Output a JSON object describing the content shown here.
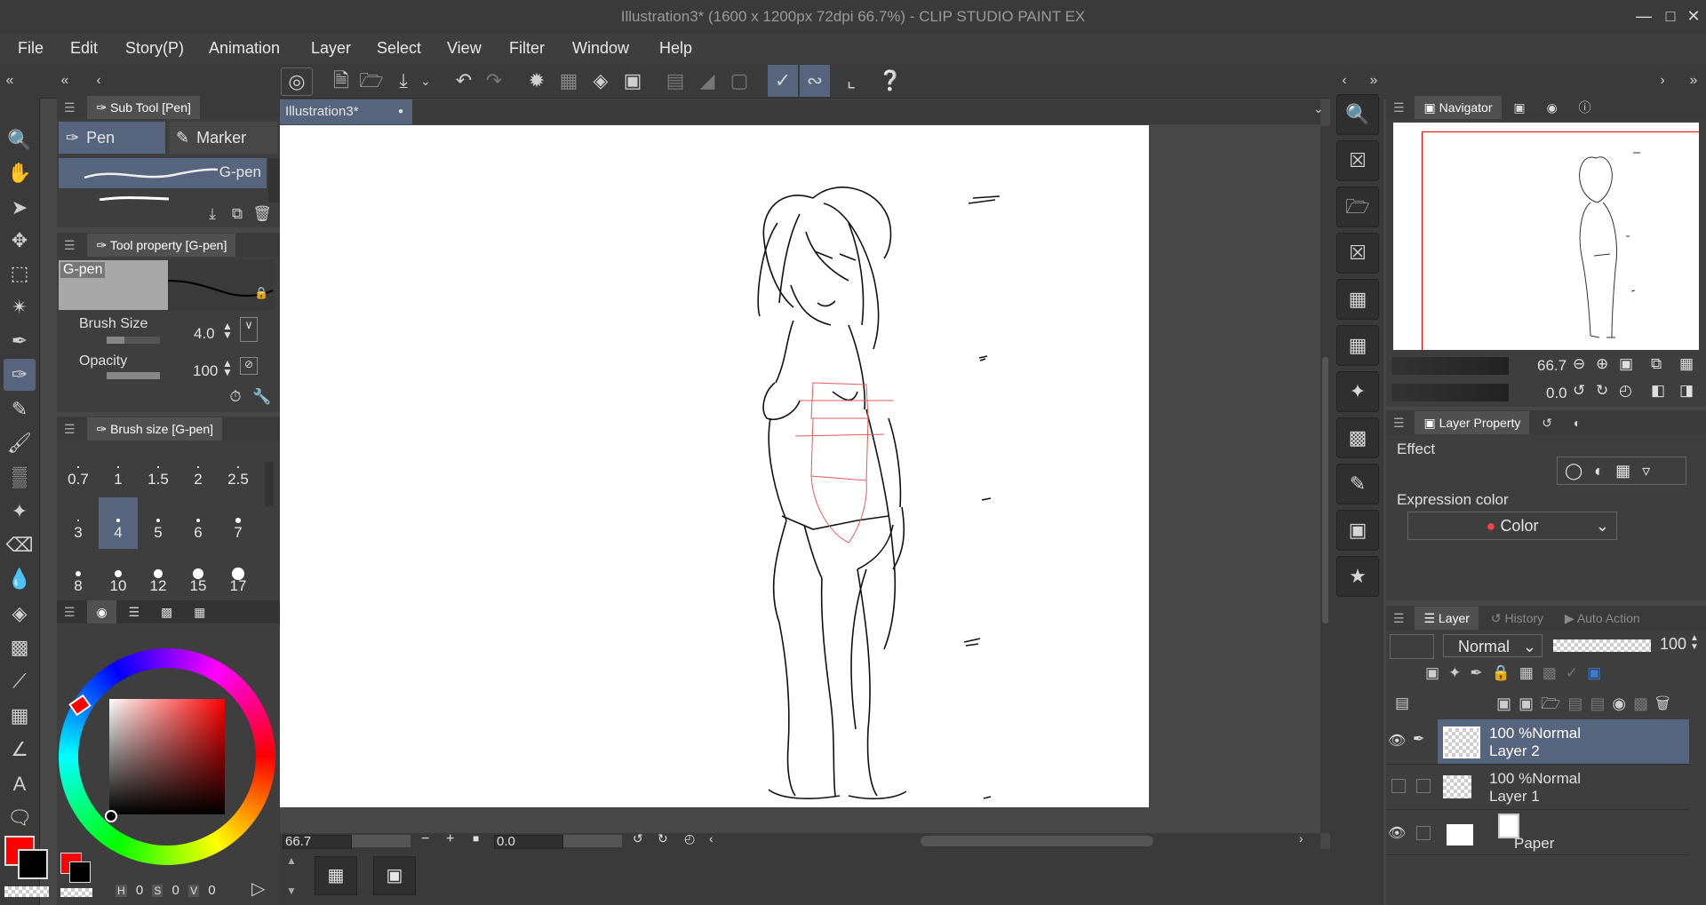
{
  "window": {
    "title": "Illustration3* (1600 x 1200px 72dpi 66.7%)  - CLIP STUDIO PAINT EX"
  },
  "menu": [
    "File",
    "Edit",
    "Story(P)",
    "Animation",
    "Layer",
    "Select",
    "View",
    "Filter",
    "Window",
    "Help"
  ],
  "subtool": {
    "header": "Sub Tool [Pen]",
    "tabs": [
      "Pen",
      "Marker"
    ],
    "active_brush": "G-pen"
  },
  "toolprop": {
    "header": "Tool property [G-pen]",
    "preview_label": "G-pen",
    "brush_size_label": "Brush Size",
    "brush_size_value": "4.0",
    "opacity_label": "Opacity",
    "opacity_value": "100"
  },
  "brushsize": {
    "header": "Brush size [G-pen]",
    "sizes": [
      "0.7",
      "1",
      "1.5",
      "2",
      "2.5",
      "3",
      "4",
      "5",
      "6",
      "7",
      "8",
      "10",
      "12",
      "15",
      "17"
    ],
    "selected": "4"
  },
  "color": {
    "main": "#ff0000",
    "sub": "#000000",
    "hsv": {
      "h_label": "H",
      "h": "0",
      "s_label": "S",
      "s": "0",
      "v_label": "V",
      "v": "0"
    }
  },
  "document": {
    "tab": "Illustration3*"
  },
  "status": {
    "zoom": "66.7",
    "angle": "0.0"
  },
  "navigator": {
    "header": "Navigator",
    "zoom": "66.7",
    "angle": "0.0"
  },
  "layerprop": {
    "header": "Layer Property",
    "effect_label": "Effect",
    "expression_label": "Expression color",
    "expression_value": "Color"
  },
  "layers": {
    "tabs": [
      "Layer",
      "History",
      "Auto Action"
    ],
    "blend": "Normal",
    "opacity": "100",
    "items": [
      {
        "mode": "100 %Normal",
        "name": "Layer 2"
      },
      {
        "mode": "100 %Normal",
        "name": "Layer 1"
      },
      {
        "name": "Paper"
      }
    ]
  }
}
